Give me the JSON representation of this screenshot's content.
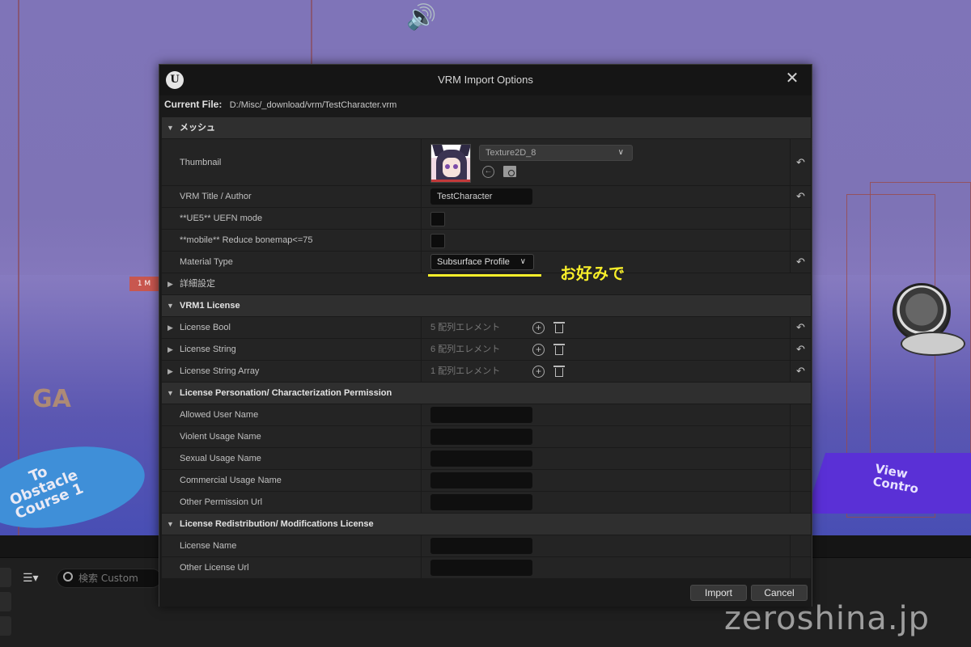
{
  "background": {
    "marker_label": "1 M",
    "floor_text": "GA",
    "disc_label": "To\nObstacle\nCourse 1",
    "pad_label": "View\nContro",
    "watermark": "zeroshina.jp"
  },
  "editor_bottom": {
    "search_placeholder": "検索 Custom"
  },
  "dialog": {
    "title": "VRM Import Options",
    "current_file_label": "Current File:",
    "current_file_path": "D:/Misc/_download/vrm/TestCharacter.vrm",
    "sections": {
      "mesh": {
        "title": "メッシュ",
        "thumbnail_label": "Thumbnail",
        "thumbnail_asset": "Texture2D_8",
        "title_author_label": "VRM Title / Author",
        "title_author_value": "TestCharacter",
        "uefn_label": "**UE5** UEFN mode",
        "bonemap_label": "**mobile** Reduce bonemap<=75",
        "material_type_label": "Material Type",
        "material_type_value": "Subsurface Profile",
        "advanced_label": "詳細設定"
      },
      "vrm1_license": {
        "title": "VRM1 License",
        "rows": [
          {
            "label": "License Bool",
            "count": "5 配列エレメント"
          },
          {
            "label": "License String",
            "count": "6 配列エレメント"
          },
          {
            "label": "License String Array",
            "count": "1 配列エレメント"
          }
        ]
      },
      "personation": {
        "title": "License Personation/ Characterization Permission",
        "rows": [
          {
            "label": "Allowed User Name",
            "value": ""
          },
          {
            "label": "Violent Usage Name",
            "value": ""
          },
          {
            "label": "Sexual Usage Name",
            "value": ""
          },
          {
            "label": "Commercial Usage Name",
            "value": ""
          },
          {
            "label": "Other Permission Url",
            "value": ""
          }
        ]
      },
      "redistribution": {
        "title": "License Redistribution/ Modifications License",
        "rows": [
          {
            "label": "License Name",
            "value": ""
          },
          {
            "label": "Other License Url",
            "value": ""
          }
        ]
      }
    },
    "annotation": "お好みで",
    "buttons": {
      "import": "Import",
      "cancel": "Cancel"
    },
    "icons": {
      "reset": "reset-arrow-icon",
      "add": "plus-circle-icon",
      "delete": "trash-icon",
      "expand": "triangle-icon"
    }
  },
  "colors": {
    "annotation": "#f7ee2a",
    "dialog_bg": "#1a1a1a",
    "section_header": "#2f2f2f",
    "row_bg": "#242424"
  }
}
